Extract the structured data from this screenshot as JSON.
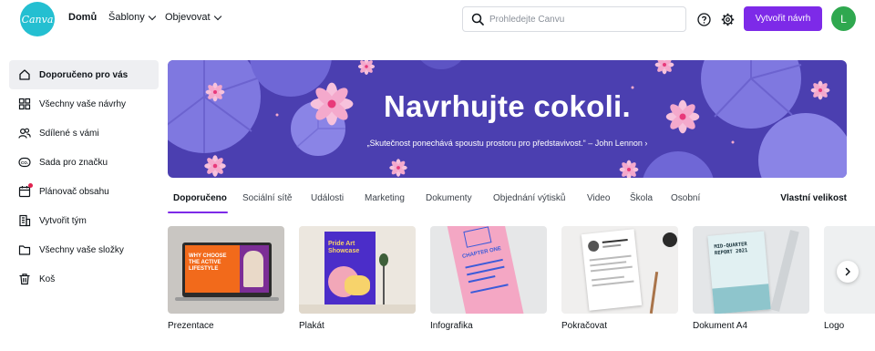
{
  "app": {
    "logo_text": "Canva"
  },
  "colors": {
    "brand": "#24bfd1",
    "accent": "#7d2ae8",
    "avatar": "#2fa84f",
    "hero_bg": "#4b3fb0"
  },
  "header": {
    "nav": [
      {
        "label": "Domů",
        "dropdown": false
      },
      {
        "label": "Šablony",
        "dropdown": true
      },
      {
        "label": "Objevovat",
        "dropdown": true
      }
    ],
    "search": {
      "placeholder": "Prohledejte Canvu",
      "value": ""
    },
    "icons": [
      "help-icon",
      "settings-icon"
    ],
    "create_button": "Vytvořit návrh",
    "avatar_letter": "L"
  },
  "sidebar": {
    "items": [
      {
        "label": "Doporučeno pro vás",
        "icon": "home-icon",
        "active": true
      },
      {
        "label": "Všechny vaše návrhy",
        "icon": "grid-icon"
      },
      {
        "label": "Sdílené s vámi",
        "icon": "people-icon"
      },
      {
        "label": "Sada pro značku",
        "icon": "brand-kit-icon"
      },
      {
        "label": "Plánovač obsahu",
        "icon": "calendar-icon",
        "badge": true
      },
      {
        "label": "Vytvořit tým",
        "icon": "building-icon"
      },
      {
        "label": "Všechny vaše složky",
        "icon": "folder-icon"
      },
      {
        "label": "Koš",
        "icon": "trash-icon"
      }
    ]
  },
  "hero": {
    "title": "Navrhujte cokoli.",
    "quote": "„Skutečnost ponechává spoustu prostoru pro představivost.“ – John Lennon ›"
  },
  "tabs": {
    "items": [
      "Doporučeno",
      "Sociální sítě",
      "Události",
      "Marketing",
      "Dokumenty",
      "Objednání výtisků",
      "Video",
      "Škola",
      "Osobní"
    ],
    "active": "Doporučeno",
    "right_link": "Vlastní velikost"
  },
  "templates": {
    "items": [
      {
        "label": "Prezentace",
        "thumb_text": "WHY CHOOSE THE ACTIVE LIFESTYLE"
      },
      {
        "label": "Plakát",
        "thumb_text": "Pride Art Showcase"
      },
      {
        "label": "Infografika",
        "thumb_text": "CHAPTER ONE"
      },
      {
        "label": "Pokračovat",
        "thumb_text": ""
      },
      {
        "label": "Dokument A4",
        "thumb_text": "MID-QUARTER REPORT 2021"
      },
      {
        "label": "Logo",
        "thumb_text": ""
      }
    ],
    "next_icon": "chevron-right-icon"
  }
}
